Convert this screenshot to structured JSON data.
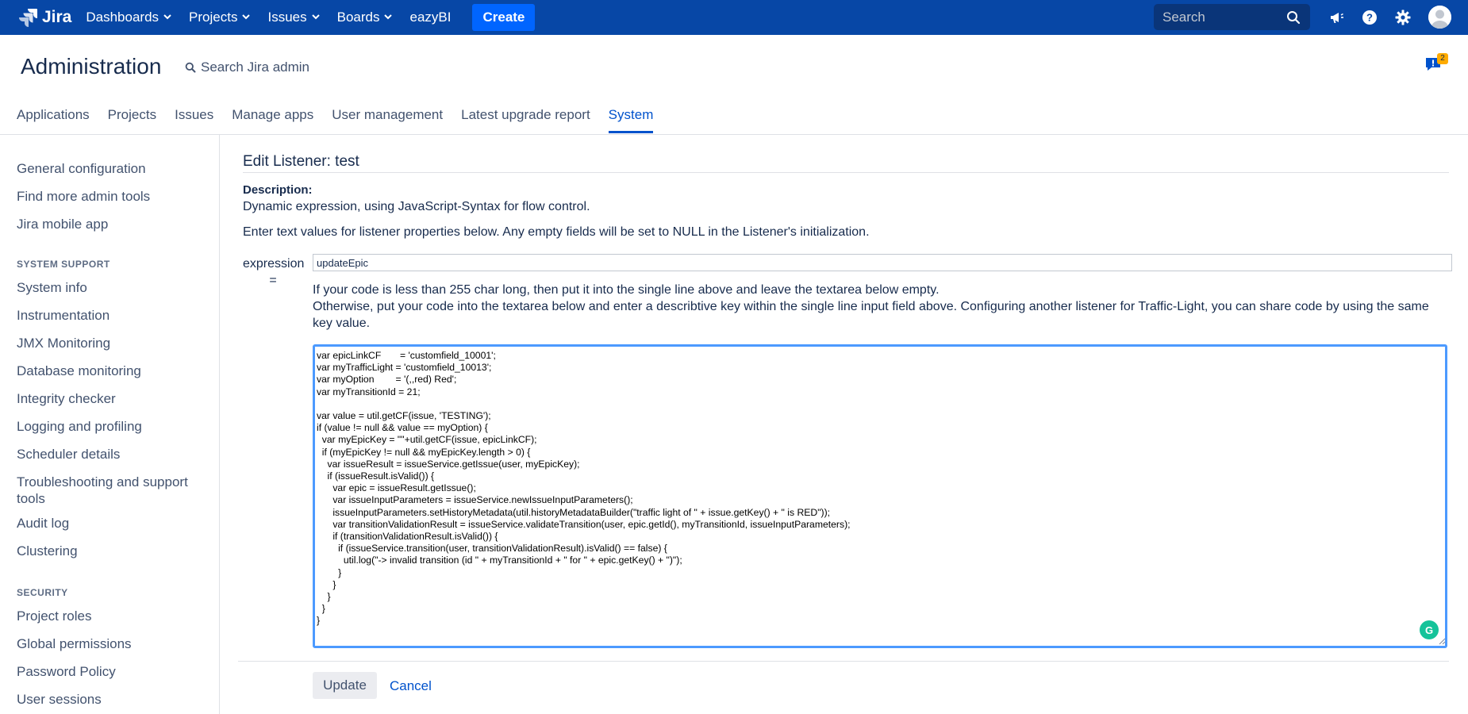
{
  "nav": {
    "logo_text": "Jira",
    "items": [
      {
        "label": "Dashboards",
        "dropdown": true
      },
      {
        "label": "Projects",
        "dropdown": true
      },
      {
        "label": "Issues",
        "dropdown": true
      },
      {
        "label": "Boards",
        "dropdown": true
      },
      {
        "label": "eazyBI",
        "dropdown": false
      }
    ],
    "create_label": "Create",
    "search_placeholder": "Search"
  },
  "admin": {
    "title": "Administration",
    "search_label": "Search Jira admin",
    "notification_count": "2",
    "tabs": [
      "Applications",
      "Projects",
      "Issues",
      "Manage apps",
      "User management",
      "Latest upgrade report",
      "System"
    ],
    "active_tab": "System"
  },
  "sidebar": {
    "items_top": [
      "General configuration",
      "Find more admin tools",
      "Jira mobile app"
    ],
    "section_support": "SYSTEM SUPPORT",
    "items_support": [
      "System info",
      "Instrumentation",
      "JMX Monitoring",
      "Database monitoring",
      "Integrity checker",
      "Logging and profiling",
      "Scheduler details",
      "Troubleshooting and support tools",
      "Audit log",
      "Clustering"
    ],
    "section_security": "SECURITY",
    "items_security": [
      "Project roles",
      "Global permissions",
      "Password Policy",
      "User sessions"
    ]
  },
  "main": {
    "heading": "Edit Listener: test",
    "description_label": "Description:",
    "description_text": "Dynamic expression, using JavaScript-Syntax for flow control.",
    "intro": "Enter text values for listener properties below. Any empty fields will be set to NULL in the Listener's initialization.",
    "field_label": "expression =",
    "expression_value": "updateEpic",
    "hint": "If your code is less than 255 char long, then put it into the single line above and leave the textarea below empty.\nOtherwise, put your code into the textarea below and enter a describtive key within the single line input field above. Configuring another listener for Traffic-Light, you can share code by using the same key value.",
    "code": "var epicLinkCF       = 'customfield_10001';\nvar myTrafficLight = 'customfield_10013';\nvar myOption        = '(,,red) Red';\nvar myTransitionId = 21;\n\nvar value = util.getCF(issue, 'TESTING');\nif (value != null && value == myOption) {\n  var myEpicKey = \"\"+util.getCF(issue, epicLinkCF);\n  if (myEpicKey != null && myEpicKey.length > 0) {\n    var issueResult = issueService.getIssue(user, myEpicKey);\n    if (issueResult.isValid()) {\n      var epic = issueResult.getIssue();\n      var issueInputParameters = issueService.newIssueInputParameters();\n      issueInputParameters.setHistoryMetadata(util.historyMetadataBuilder(\"traffic light of \" + issue.getKey() + \" is RED\"));\n      var transitionValidationResult = issueService.validateTransition(user, epic.getId(), myTransitionId, issueInputParameters);\n      if (transitionValidationResult.isValid()) {\n        if (issueService.transition(user, transitionValidationResult).isValid() == false) {\n          util.log(\"-> invalid transition (id \" + myTransitionId + \" for \" + epic.getKey() + \")\");\n        }\n      }\n    }\n  }\n}",
    "update_label": "Update",
    "cancel_label": "Cancel"
  }
}
